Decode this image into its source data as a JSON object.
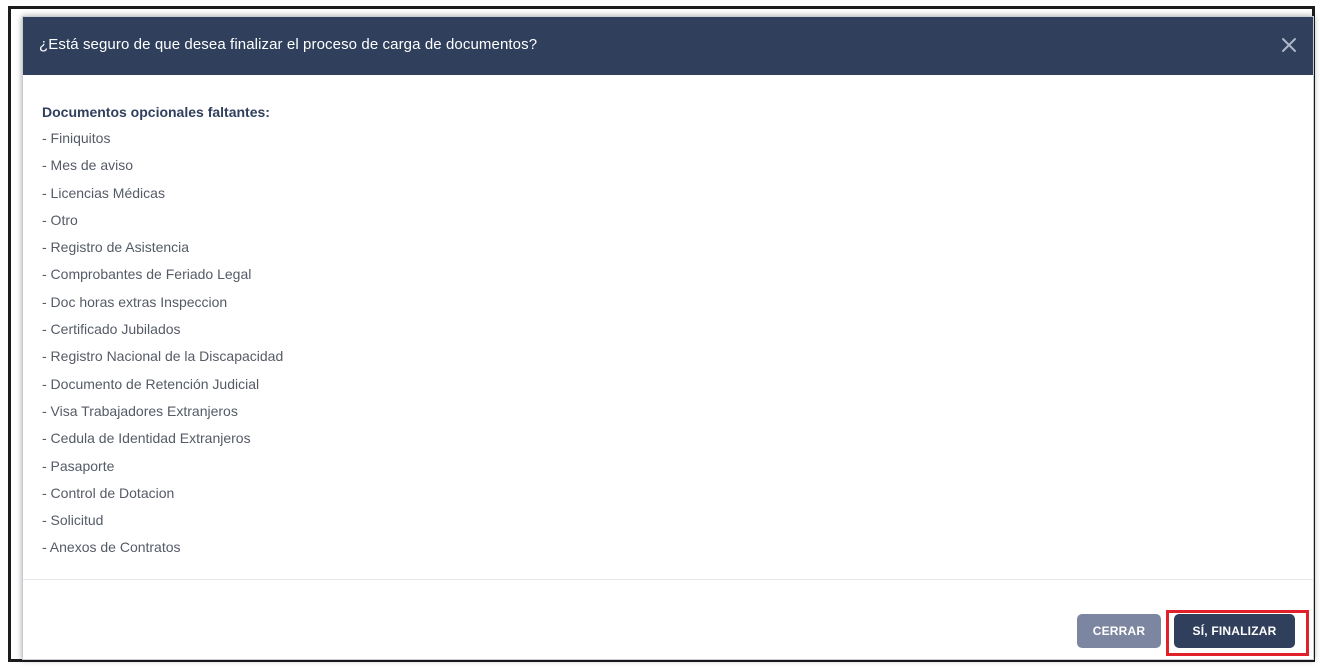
{
  "dialog": {
    "title": "¿Está seguro de que desea finalizar el proceso de carga de documentos?",
    "close_icon": "close-icon",
    "colors": {
      "header": "#2f3f5c",
      "primary_button": "#2f3f5c",
      "secondary_button": "#7d86a0",
      "highlight": "#e0202a"
    }
  },
  "body": {
    "heading": "Documentos opcionales faltantes:",
    "items": [
      "- Finiquitos",
      "- Mes de aviso",
      "- Licencias Médicas",
      "- Otro",
      "- Registro de Asistencia",
      "- Comprobantes de Feriado Legal",
      "- Doc horas extras Inspeccion",
      "- Certificado Jubilados",
      "- Registro Nacional de la Discapacidad",
      "- Documento de Retención Judicial",
      "- Visa Trabajadores Extranjeros",
      "- Cedula de Identidad Extranjeros",
      "- Pasaporte",
      "- Control de Dotacion",
      "- Solicitud",
      "- Anexos de Contratos"
    ]
  },
  "footer": {
    "cancel_label": "CERRAR",
    "confirm_label": "SÍ, FINALIZAR"
  }
}
